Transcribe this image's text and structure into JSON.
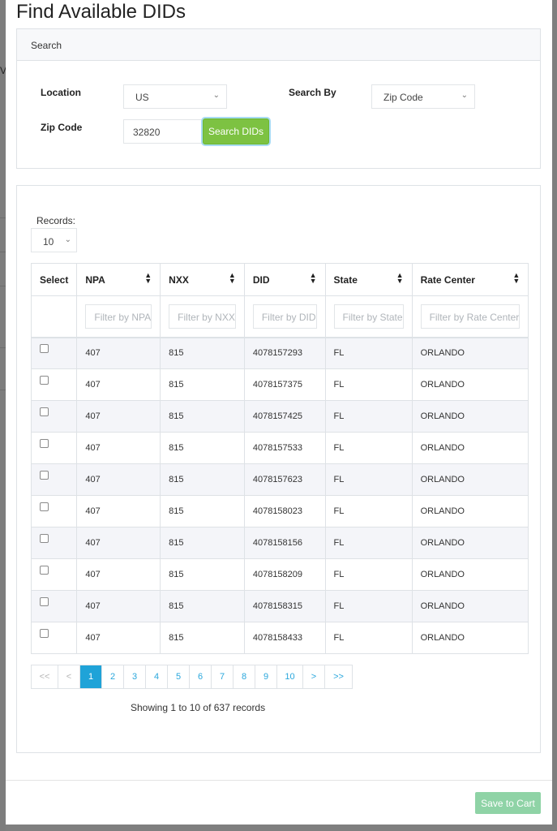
{
  "modal": {
    "title": "Find Available DIDs"
  },
  "search": {
    "header": "Search",
    "location_label": "Location",
    "location_value": "US",
    "search_by_label": "Search By",
    "search_by_value": "Zip Code",
    "zip_label": "Zip Code",
    "zip_value": "32820",
    "search_button": "Search DIDs"
  },
  "results": {
    "records_label": "Records:",
    "records_value": "10",
    "columns": [
      "Select",
      "NPA",
      "NXX",
      "DID",
      "State",
      "Rate Center"
    ],
    "filters": {
      "npa": "Filter by NPA",
      "nxx": "Filter by NXX",
      "did": "Filter by DID",
      "state": "Filter by State",
      "rate_center": "Filter by Rate Center"
    },
    "rows": [
      {
        "npa": "407",
        "nxx": "815",
        "did": "4078157293",
        "state": "FL",
        "rate_center": "ORLANDO"
      },
      {
        "npa": "407",
        "nxx": "815",
        "did": "4078157375",
        "state": "FL",
        "rate_center": "ORLANDO"
      },
      {
        "npa": "407",
        "nxx": "815",
        "did": "4078157425",
        "state": "FL",
        "rate_center": "ORLANDO"
      },
      {
        "npa": "407",
        "nxx": "815",
        "did": "4078157533",
        "state": "FL",
        "rate_center": "ORLANDO"
      },
      {
        "npa": "407",
        "nxx": "815",
        "did": "4078157623",
        "state": "FL",
        "rate_center": "ORLANDO"
      },
      {
        "npa": "407",
        "nxx": "815",
        "did": "4078158023",
        "state": "FL",
        "rate_center": "ORLANDO"
      },
      {
        "npa": "407",
        "nxx": "815",
        "did": "4078158156",
        "state": "FL",
        "rate_center": "ORLANDO"
      },
      {
        "npa": "407",
        "nxx": "815",
        "did": "4078158209",
        "state": "FL",
        "rate_center": "ORLANDO"
      },
      {
        "npa": "407",
        "nxx": "815",
        "did": "4078158315",
        "state": "FL",
        "rate_center": "ORLANDO"
      },
      {
        "npa": "407",
        "nxx": "815",
        "did": "4078158433",
        "state": "FL",
        "rate_center": "ORLANDO"
      }
    ],
    "pagination": {
      "first": "<<",
      "prev": "<",
      "pages": [
        "1",
        "2",
        "3",
        "4",
        "5",
        "6",
        "7",
        "8",
        "9",
        "10"
      ],
      "current_page": "1",
      "next": ">",
      "last": ">>"
    },
    "showing_text": "Showing 1 to 10 of 637 records"
  },
  "footer": {
    "save_button": "Save to Cart"
  },
  "icons": {
    "chevron": "⌄",
    "sort": "▲▼"
  },
  "colors": {
    "search_button": "#7dc242",
    "active_page": "#1fa3d8",
    "save_button": "#8fd3a6"
  }
}
